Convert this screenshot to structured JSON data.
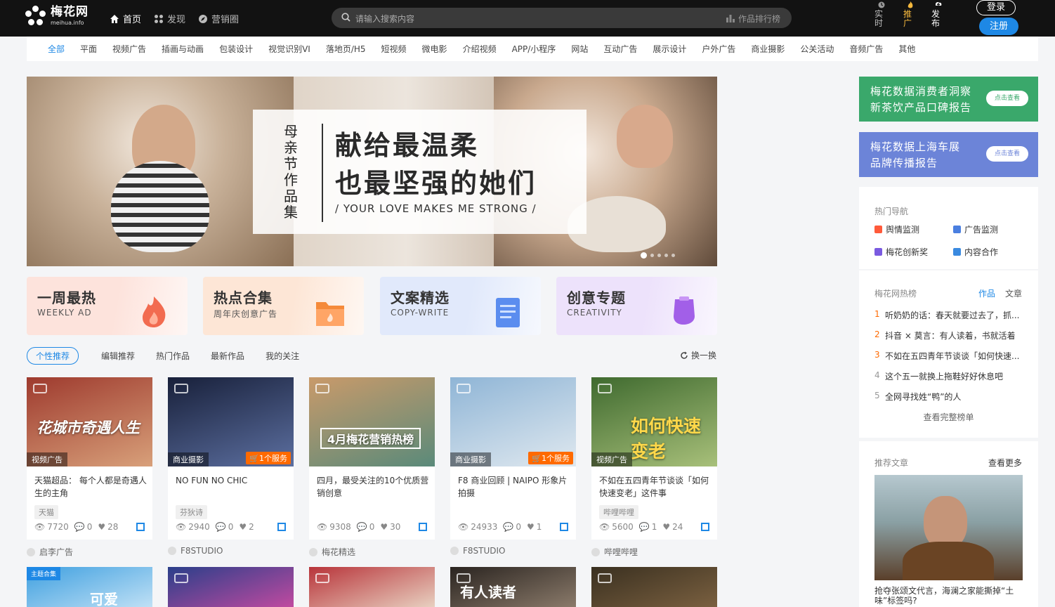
{
  "header": {
    "logo_cn": "梅花网",
    "logo_en": "meihua.info",
    "nav": [
      {
        "label": "首页",
        "icon": "home-icon"
      },
      {
        "label": "发现",
        "icon": "grid-icon"
      },
      {
        "label": "营销圈",
        "icon": "compass-icon"
      }
    ],
    "search_placeholder": "请输入搜索内容",
    "rank_label": "作品排行榜",
    "quick": [
      {
        "label": "实时",
        "icon": "clock-icon"
      },
      {
        "label": "推广",
        "icon": "flame-icon"
      },
      {
        "label": "发布",
        "icon": "upload-icon"
      }
    ],
    "login_label": "登录",
    "register_label": "注册"
  },
  "categories": [
    "全部",
    "平面",
    "视频广告",
    "插画与动画",
    "包装设计",
    "视觉识别VI",
    "落地页/H5",
    "短视频",
    "微电影",
    "介绍视频",
    "APP/小程序",
    "网站",
    "互动广告",
    "展示设计",
    "户外广告",
    "商业摄影",
    "公关活动",
    "音频广告",
    "其他"
  ],
  "banner": {
    "side": "母亲节作品集",
    "line1": "献给最温柔",
    "line2": "也最坚强的她们",
    "en": "/ YOUR LOVE MAKES ME STRONG /"
  },
  "tiles": [
    {
      "title": "一周最热",
      "sub": "WEEKLY AD",
      "icon": "flame-icon",
      "bg": "#fde3dc",
      "accent": "#f26b50"
    },
    {
      "title": "热点合集",
      "sub": "周年庆创意广告",
      "icon": "folder-icon",
      "bg": "#fde6d6",
      "accent": "#f58a3a"
    },
    {
      "title": "文案精选",
      "sub": "COPY-WRITE",
      "icon": "document-icon",
      "bg": "#e1e9fb",
      "accent": "#5b8def"
    },
    {
      "title": "创意专题",
      "sub": "CREATIVITY",
      "icon": "bulb-icon",
      "bg": "#ede2fb",
      "accent": "#a25fe8"
    }
  ],
  "tabs": [
    "个性推荐",
    "编辑推荐",
    "热门作品",
    "最新作品",
    "我的关注"
  ],
  "shuffle_label": "换一换",
  "cards": [
    {
      "overlay": "花城市奇遇人生",
      "tag": "视频广告",
      "service": "",
      "title": "天猫超品： 每个人都是奇遇人生的主角",
      "brand": "天猫",
      "views": "7720",
      "comments": "0",
      "likes": "28",
      "author": "启李广告",
      "bg1": "#9e3a2e",
      "bg2": "#d8a07a"
    },
    {
      "overlay": "",
      "tag": "商业摄影",
      "service": "1个服务",
      "title": "NO FUN NO CHIC",
      "brand": "芬狄诗",
      "views": "2940",
      "comments": "0",
      "likes": "2",
      "author": "F8STUDIO",
      "bg1": "#18203a",
      "bg2": "#5c6fa0"
    },
    {
      "overlay": "4月梅花营销热榜",
      "tag": "",
      "service": "",
      "title": "四月，最受关注的10个优质营销创意",
      "brand": "",
      "views": "9308",
      "comments": "0",
      "likes": "30",
      "author": "梅花精选",
      "bg1": "#c99a6a",
      "bg2": "#5a8a7a"
    },
    {
      "overlay": "",
      "tag": "商业摄影",
      "service": "1个服务",
      "title": "F8 商业回顾 | NAIPO 形象片拍摄",
      "brand": "",
      "views": "24933",
      "comments": "0",
      "likes": "1",
      "author": "F8STUDIO",
      "bg1": "#8fb5d6",
      "bg2": "#dfe8ef"
    },
    {
      "overlay": "如何快速变老",
      "tag": "视频广告",
      "service": "",
      "title": "不如在五四青年节谈谈「如何快速变老」这件事",
      "brand": "哔哩哔哩",
      "views": "5600",
      "comments": "1",
      "likes": "24",
      "author": "哔哩哔哩",
      "bg1": "#3f6a2f",
      "bg2": "#a8c07a"
    }
  ],
  "row2_cards": [
    {
      "overlay": "可爱",
      "badge": "主题合集",
      "bg1": "#3fa0e0",
      "bg2": "#bfe0f5"
    },
    {
      "overlay": "",
      "badge": "",
      "bg1": "#2a3f8a",
      "bg2": "#c04aa0"
    },
    {
      "overlay": "",
      "badge": "",
      "bg1": "#b8343a",
      "bg2": "#e8d0c0"
    },
    {
      "overlay": "有人读者",
      "badge": "",
      "bg1": "#2a2420",
      "bg2": "#8a7a6a"
    },
    {
      "overlay": "",
      "badge": "",
      "bg1": "#3a3020",
      "bg2": "#7a6040"
    }
  ],
  "right": {
    "ads": [
      {
        "text": "梅花数据消费者洞察新茶饮产品口碑报告",
        "line1": "梅花数据消费者洞察",
        "line2": "新茶饮产品口碑报告",
        "button": "点击查看",
        "color": "#3aa86b"
      },
      {
        "text": "梅花数据上海车展品牌传播报告",
        "line1": "梅花数据上海车展",
        "line2": "品牌传播报告",
        "button": "点击查看",
        "color": "#6c84d8"
      }
    ],
    "hot_nav_title": "热门导航",
    "hot_nav": [
      {
        "label": "舆情监测",
        "icon": "star-icon",
        "color": "#ff5a3a"
      },
      {
        "label": "广告监测",
        "icon": "ad-icon",
        "color": "#4a7fe0"
      },
      {
        "label": "梅花创新奖",
        "icon": "flag-icon",
        "color": "#7a5ae0"
      },
      {
        "label": "内容合作",
        "icon": "gear-icon",
        "color": "#3a8ae0"
      }
    ],
    "rank_title": "梅花网热榜",
    "rank_tabs": [
      "作品",
      "文章"
    ],
    "rank_items": [
      "听奶奶的话：春天就要过去了，抓...",
      "抖音 × 莫言：有人读着，书就活着",
      "不如在五四青年节谈谈「如何快速...",
      "这个五一就换上拖鞋好好休息吧",
      "全网寻找姓“鸭”的人"
    ],
    "rank_more": "查看完整榜单",
    "articles_title": "推荐文章",
    "articles_more": "查看更多",
    "article_title": "抢夺张颂文代言，海澜之家能撕掉“土味”标签吗?"
  }
}
